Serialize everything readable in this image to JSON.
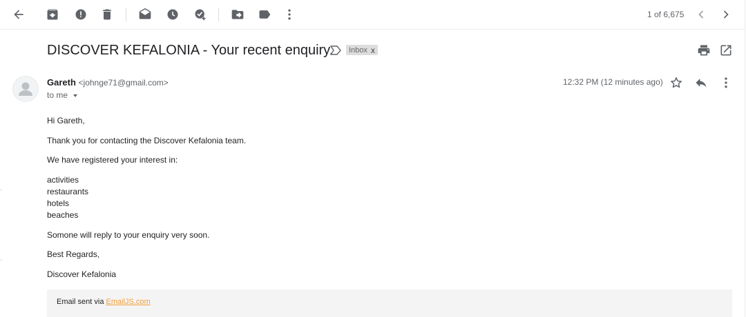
{
  "toolbar": {
    "icons": [
      "back-arrow-icon",
      "archive-icon",
      "report-spam-icon",
      "delete-icon",
      "mark-unread-icon",
      "snooze-icon",
      "add-to-tasks-icon",
      "move-to-icon",
      "labels-icon",
      "more-vert-icon"
    ],
    "pager": "1 of 6,675"
  },
  "subject": "DISCOVER KEFALONIA - Your recent enquiry.",
  "label": {
    "name": "Inbox",
    "remove": "x"
  },
  "message": {
    "sender_name": "Gareth",
    "sender_email": "<johnge71@gmail.com>",
    "to": "to me",
    "time": "12:32 PM (12 minutes ago)"
  },
  "body": {
    "greeting": "Hi Gareth,",
    "thanks": "Thank you for contacting the Discover Kefalonia team.",
    "registered": "We have registered your interest in:",
    "interests": [
      "activities",
      "restaurants",
      "hotels",
      "beaches"
    ],
    "reply": "Somone will reply to your enquiry very soon.",
    "regards": "Best Regards,",
    "signature": "Discover Kefalonia"
  },
  "footer": {
    "prefix": "Email sent via ",
    "link": "EmailJS.com"
  },
  "colors": {
    "icon": "#5f6368",
    "link": "#f29e3d",
    "chip": "#dddddd"
  }
}
